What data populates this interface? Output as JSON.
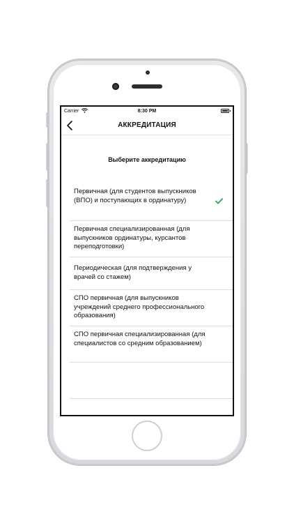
{
  "status_bar": {
    "carrier": "Carrier",
    "time": "8:30 PM"
  },
  "nav": {
    "title": "АККРЕДИТАЦИЯ",
    "back_icon": "chevron-left-icon"
  },
  "prompt": "Выберите аккредитацию",
  "options": [
    {
      "label": "Первичная (для студентов выпускников (ВПО) и поступающих в ординатуру)",
      "selected": true
    },
    {
      "label": "Первичная специализированная (для выпускников ординатуры, курсантов переподготовки)",
      "selected": false
    },
    {
      "label": "Периодическая (для подтверждения у врачей со стажем)",
      "selected": false
    },
    {
      "label": "СПО первичная (для выпускников учреждений среднего профессионального образования)",
      "selected": false
    },
    {
      "label": "СПО первичная специализированная (для специалистов со средним образованием)",
      "selected": false
    }
  ],
  "colors": {
    "checkmark": "#34a853",
    "text": "#111111",
    "divider": "#dcdcdc"
  }
}
